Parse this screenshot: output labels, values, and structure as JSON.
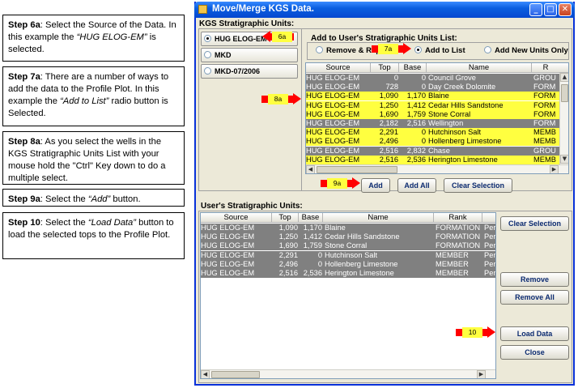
{
  "steps": [
    {
      "label": "Step 6a",
      "parts": [
        ": Select the Source of the Data.  In this example the ",
        "“HUG ELOG-EM”",
        " is selected."
      ]
    },
    {
      "label": "Step 7a",
      "parts": [
        ": There are a number of ways to add the data to the Profile Plot.  In this example the ",
        "“Add to List”",
        " radio button is Selected."
      ]
    },
    {
      "label": "Step 8a",
      "parts": [
        ": As you select the wells in the KGS Stratigraphic Units List with your mouse hold the \"Ctrl\" Key down to do a multiple select.",
        "",
        ""
      ]
    },
    {
      "label": "Step 9a",
      "parts": [
        ": Select the ",
        "“Add”",
        " button."
      ]
    },
    {
      "label": "Step 10",
      "parts": [
        ": Select the ",
        "“Load Data”",
        " button to load the selected tops to the Profile Plot."
      ]
    }
  ],
  "window": {
    "title": "Move/Merge KGS Data.",
    "kgs_panel_title": "KGS Stratigraphic Units:",
    "sources": [
      "HUG ELOG-EM",
      "MKD",
      "MKD-07/2006"
    ],
    "add_panel_title": "Add to User's Stratigraphic Units List:",
    "radio_remove": "Remove & Replace",
    "radio_add_list": "Add to List",
    "radio_add_new": "Add New Units Only",
    "kgs_columns": [
      "Source",
      "Top",
      "Base",
      "Name",
      "R"
    ],
    "kgs_rows": [
      {
        "source": "HUG ELOG-EM",
        "top": "0",
        "base": "0",
        "name": "Council Grove",
        "rank": "GROU",
        "sel": false
      },
      {
        "source": "HUG ELOG-EM",
        "top": "728",
        "base": "0",
        "name": "Day Creek Dolomite",
        "rank": "FORM",
        "sel": false
      },
      {
        "source": "HUG ELOG-EM",
        "top": "1,090",
        "base": "1,170",
        "name": "Blaine",
        "rank": "FORM",
        "sel": true
      },
      {
        "source": "HUG ELOG-EM",
        "top": "1,250",
        "base": "1,412",
        "name": "Cedar Hills Sandstone",
        "rank": "FORM",
        "sel": true
      },
      {
        "source": "HUG ELOG-EM",
        "top": "1,690",
        "base": "1,759",
        "name": "Stone Corral",
        "rank": "FORM",
        "sel": true
      },
      {
        "source": "HUG ELOG-EM",
        "top": "2,182",
        "base": "2,516",
        "name": "Wellington",
        "rank": "FORM",
        "sel": false
      },
      {
        "source": "HUG ELOG-EM",
        "top": "2,291",
        "base": "0",
        "name": "Hutchinson Salt",
        "rank": "MEMB",
        "sel": true
      },
      {
        "source": "HUG ELOG-EM",
        "top": "2,496",
        "base": "0",
        "name": "Hollenberg Limestone",
        "rank": "MEMB",
        "sel": true
      },
      {
        "source": "HUG ELOG-EM",
        "top": "2,516",
        "base": "2,832",
        "name": "Chase",
        "rank": "GROU",
        "sel": false
      },
      {
        "source": "HUG ELOG-EM",
        "top": "2,516",
        "base": "2,536",
        "name": "Herington Limestone",
        "rank": "MEMB",
        "sel": true
      }
    ],
    "btn_add": "Add",
    "btn_add_all": "Add All",
    "btn_clear_selection_top": "Clear Selection",
    "user_panel_title": "User's Stratigraphic Units:",
    "user_columns": [
      "Source",
      "Top",
      "Base",
      "Name",
      "Rank",
      ""
    ],
    "user_rows": [
      {
        "source": "HUG ELOG-EM",
        "top": "1,090",
        "base": "1,170",
        "name": "Blaine",
        "rank": "FORMATION",
        "extra": "Perm"
      },
      {
        "source": "HUG ELOG-EM",
        "top": "1,250",
        "base": "1,412",
        "name": "Cedar Hills Sandstone",
        "rank": "FORMATION",
        "extra": "Perm"
      },
      {
        "source": "HUG ELOG-EM",
        "top": "1,690",
        "base": "1,759",
        "name": "Stone Corral",
        "rank": "FORMATION",
        "extra": "Perm"
      },
      {
        "source": "HUG ELOG-EM",
        "top": "2,291",
        "base": "0",
        "name": "Hutchinson Salt",
        "rank": "MEMBER",
        "extra": "Perm"
      },
      {
        "source": "HUG ELOG-EM",
        "top": "2,496",
        "base": "0",
        "name": "Hollenberg Limestone",
        "rank": "MEMBER",
        "extra": "Perm"
      },
      {
        "source": "HUG ELOG-EM",
        "top": "2,516",
        "base": "2,536",
        "name": "Herington Limestone",
        "rank": "MEMBER",
        "extra": "Perm"
      }
    ],
    "btn_clear_selection": "Clear Selection",
    "btn_remove": "Remove",
    "btn_remove_all": "Remove All",
    "btn_load_data": "Load Data",
    "btn_close": "Close"
  },
  "markers": {
    "m6a": "6a",
    "m7a": "7a",
    "m8a": "8a",
    "m9a": "9a",
    "m10": "10"
  },
  "colors": {
    "selected_row": "#ffff40",
    "unselected_row": "#808080",
    "marker": "#ff0000",
    "titlebar": "#0a5ee0"
  }
}
